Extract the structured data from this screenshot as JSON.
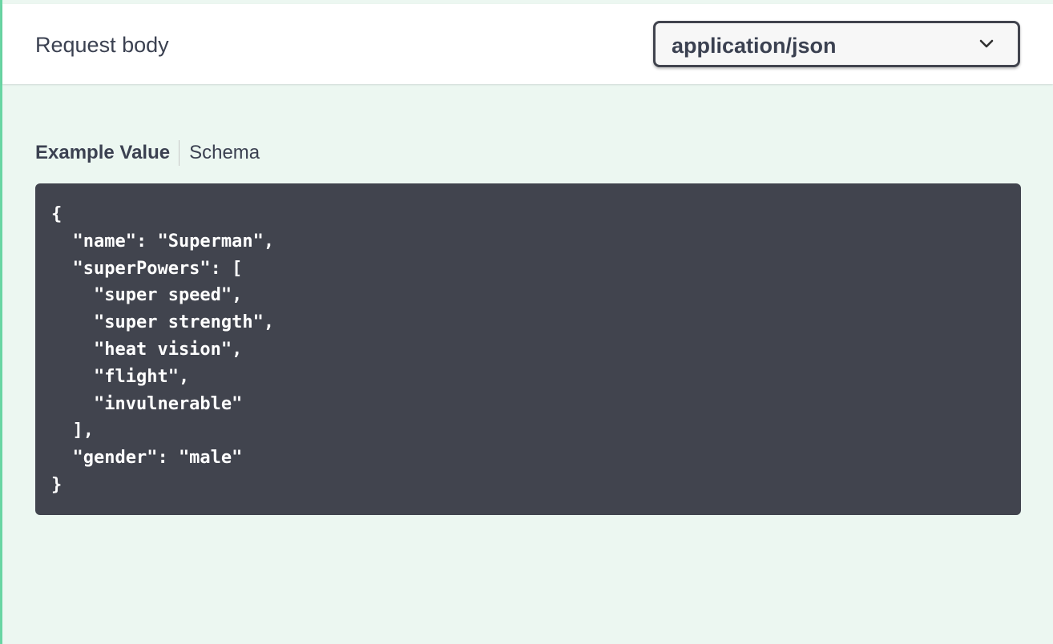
{
  "request_body": {
    "title": "Request body",
    "content_type": {
      "selected": "application/json",
      "icon": "chevron-down-icon"
    }
  },
  "tabs": [
    {
      "label": "Example Value",
      "active": true
    },
    {
      "label": "Schema",
      "active": false
    }
  ],
  "example_value": "{\n  \"name\": \"Superman\",\n  \"superPowers\": [\n    \"super speed\",\n    \"super strength\",\n    \"heat vision\",\n    \"flight\",\n    \"invulnerable\"\n  ],\n  \"gender\": \"male\"\n}",
  "colors": {
    "background": "#ecf7f1",
    "accent_border": "#49cc90",
    "code_background": "#41444e",
    "text": "#3b4151"
  }
}
